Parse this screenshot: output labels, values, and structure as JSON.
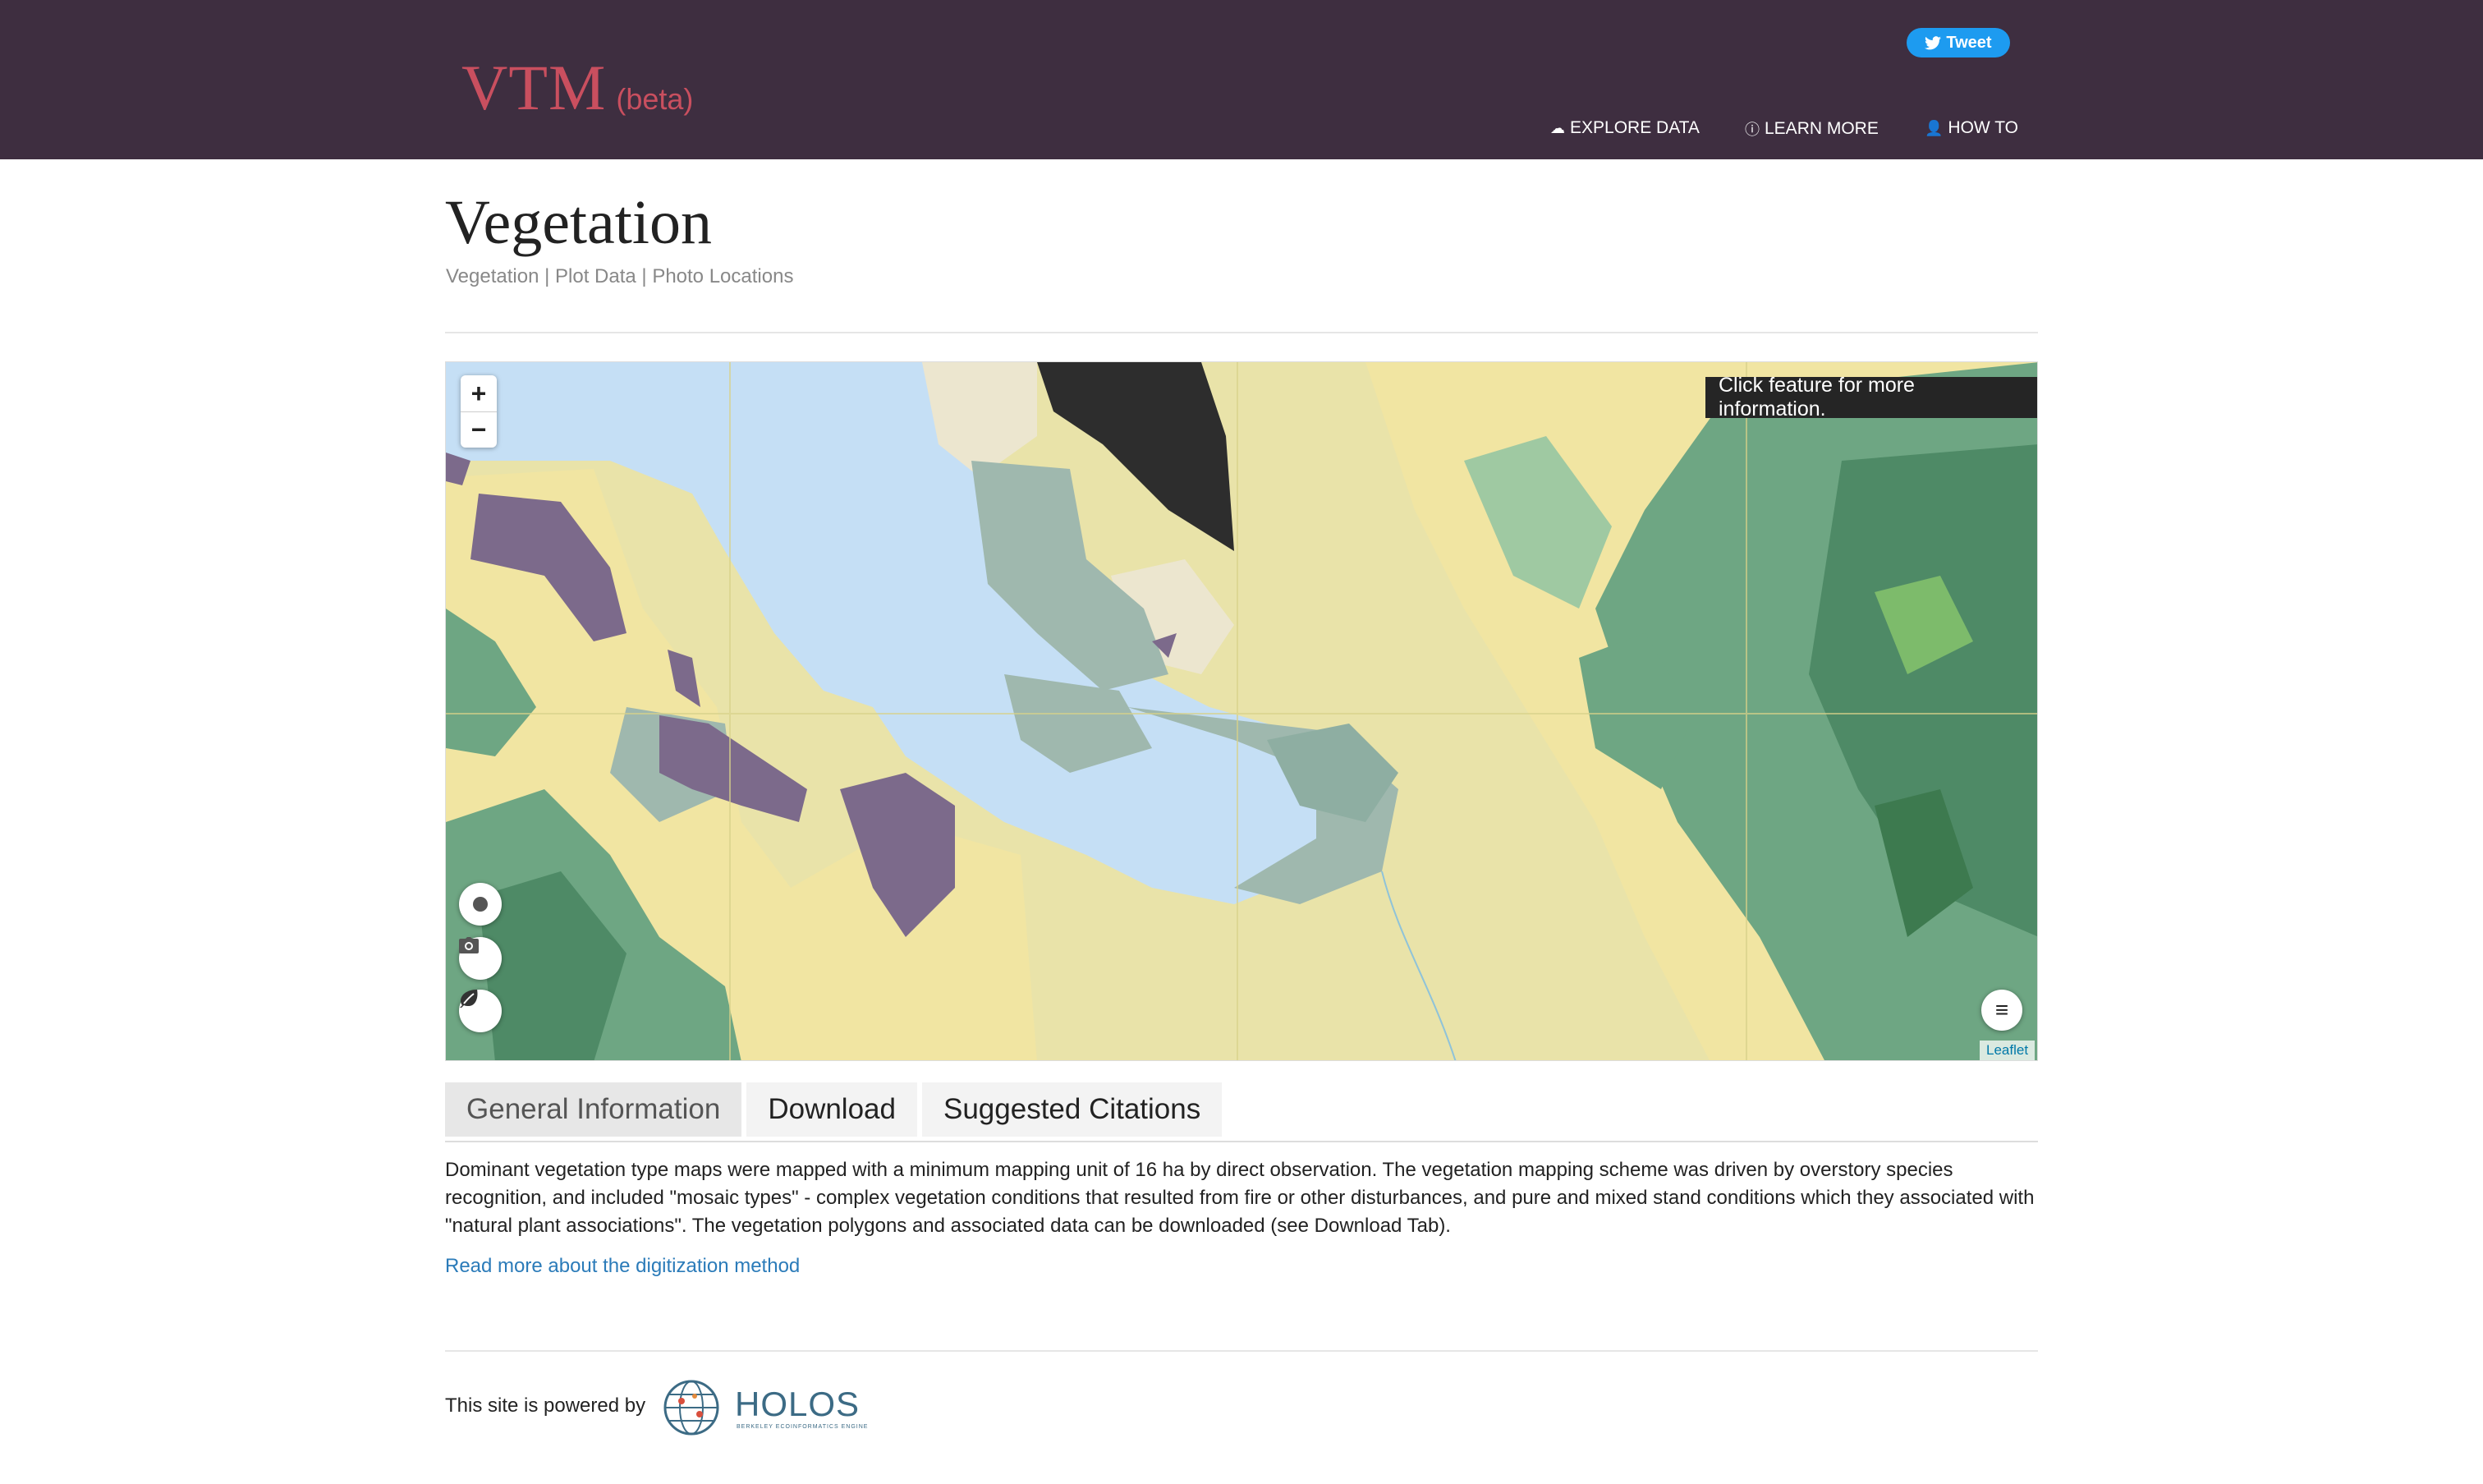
{
  "header": {
    "brand": "VTM",
    "brand_suffix": "(beta)",
    "tweet_label": "Tweet",
    "nav": [
      {
        "label": "EXPLORE DATA",
        "icon": "cloud-download-icon"
      },
      {
        "label": "LEARN MORE",
        "icon": "info-circle-icon"
      },
      {
        "label": "HOW TO",
        "icon": "user-icon"
      }
    ]
  },
  "page": {
    "title": "Vegetation",
    "subnav": [
      "Vegetation",
      "Plot Data",
      "Photo Locations"
    ],
    "subnav_separator": "|"
  },
  "map": {
    "zoom_in": "+",
    "zoom_out": "−",
    "info_text": "Click feature for more information.",
    "attribution": "Leaflet",
    "controls": [
      "plot-points-icon",
      "camera-icon",
      "leaf-icon"
    ],
    "layers_icon": "layers-menu-icon",
    "colors": {
      "water": "#c5dff5",
      "grassland": "#e9e3a9",
      "shrub": "#f1e5a2",
      "purple": "#7c6a8b",
      "marsh": "#9fb8ae",
      "forest": "#6ea683",
      "dark_forest": "#4e8a66",
      "urban": "#2d2d2d",
      "light": "#ece6cf"
    }
  },
  "tabs": [
    {
      "label": "General Information",
      "active": true
    },
    {
      "label": "Download",
      "active": false
    },
    {
      "label": "Suggested Citations",
      "active": false
    }
  ],
  "content": {
    "description": "Dominant vegetation type maps were mapped with a minimum mapping unit of 16 ha by direct observation. The vegetation mapping scheme was driven by overstory species recognition, and included \"mosaic types\" - complex vegetation conditions that resulted from fire or other disturbances, and pure and mixed stand conditions which they associated with \"natural plant associations\". The vegetation polygons and associated data can be downloaded (see Download Tab).",
    "read_more": "Read more about the digitization method"
  },
  "footer": {
    "powered_by": "This site is powered by",
    "logo_name": "HOLOS",
    "logo_tagline": "BERKELEY ECOINFORMATICS ENGINE"
  }
}
